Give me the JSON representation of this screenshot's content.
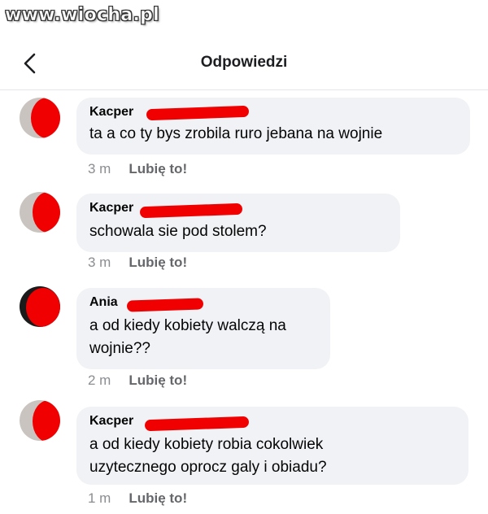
{
  "watermark": "www.wiocha.pl",
  "header": {
    "title": "Odpowiedzi",
    "back_icon": "chevron-left-icon"
  },
  "comments": [
    {
      "author": "Kacper",
      "text": "ta a co ty bys zrobila ruro jebana na wojnie",
      "time": "3 m",
      "like_label": "Lubię to!"
    },
    {
      "author": "Kacper",
      "text": "schowala sie pod stolem?",
      "time": "3 m",
      "like_label": "Lubię to!"
    },
    {
      "author": "Ania",
      "text": "a od kiedy kobiety walczą na wojnie??",
      "time": "2 m",
      "like_label": "Lubię to!"
    },
    {
      "author": "Kacper",
      "text": "a od kiedy kobiety robia cokolwiek uzytecznego oprocz galy i obiadu?",
      "time": "1 m",
      "like_label": "Lubię to!"
    }
  ],
  "colors": {
    "bubble": "#f0f2f5",
    "redaction": "#f00000",
    "meta_gray": "#8a8d91"
  }
}
